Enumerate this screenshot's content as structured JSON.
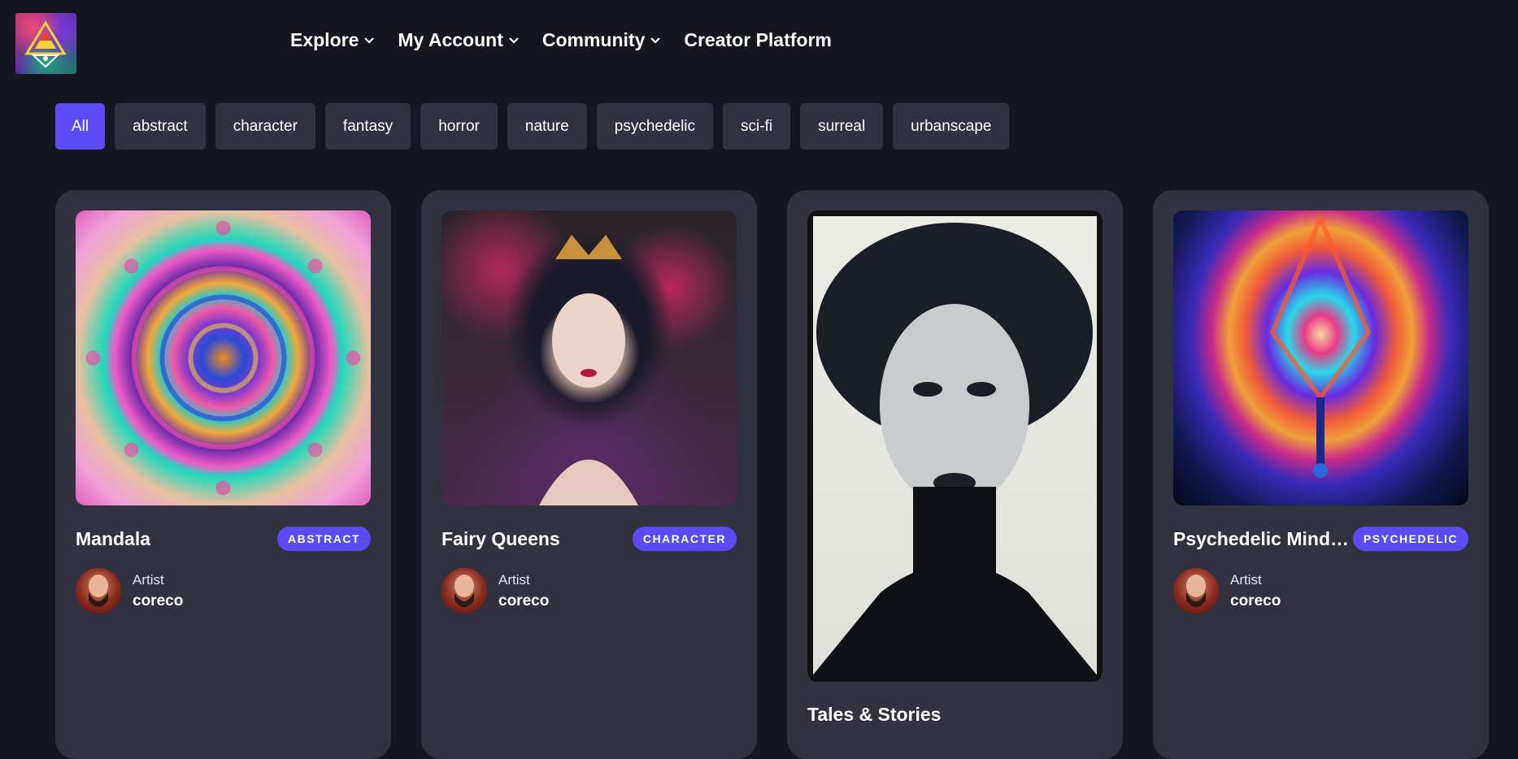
{
  "header": {
    "logo_icon": "triangle-logo-icon",
    "nav": [
      {
        "label": "Explore",
        "has_dropdown": true
      },
      {
        "label": "My Account",
        "has_dropdown": true
      },
      {
        "label": "Community",
        "has_dropdown": true
      },
      {
        "label": "Creator Platform",
        "has_dropdown": false
      }
    ]
  },
  "filters": {
    "selected": "All",
    "items": [
      "All",
      "abstract",
      "character",
      "fantasy",
      "horror",
      "nature",
      "psychedelic",
      "sci-fi",
      "surreal",
      "urbanscape"
    ]
  },
  "colors": {
    "background": "#161620",
    "card": "#32313f",
    "accent": "#5a4bf5"
  },
  "cards": [
    {
      "title": "Mandala",
      "badge": "ABSTRACT",
      "artist_role": "Artist",
      "artist_name": "coreco",
      "art": "mandala-artwork"
    },
    {
      "title": "Fairy Queens",
      "badge": "CHARACTER",
      "artist_role": "Artist",
      "artist_name": "coreco",
      "art": "fairy-queen-artwork"
    },
    {
      "title": "Tales & Stories",
      "badge": "",
      "artist_role": "",
      "artist_name": "",
      "art": "monochrome-portrait-artwork"
    },
    {
      "title": "Psychedelic Mindscapes",
      "badge": "PSYCHEDELIC",
      "artist_role": "Artist",
      "artist_name": "coreco",
      "art": "psychedelic-landscape-artwork"
    }
  ]
}
